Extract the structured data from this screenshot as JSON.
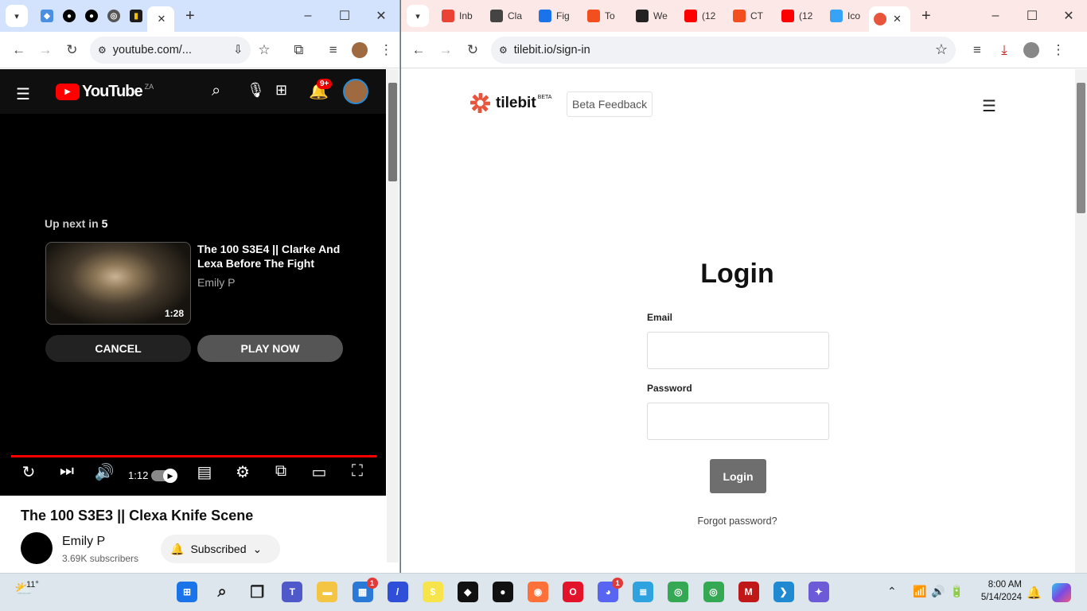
{
  "left_window": {
    "tabs": [
      {
        "favicon": "inbox-icon",
        "color": "#4a90e2"
      },
      {
        "favicon": "github-icon",
        "color": "#000000"
      },
      {
        "favicon": "github-icon",
        "color": "#000000"
      },
      {
        "favicon": "globe-icon",
        "color": "#555555"
      },
      {
        "favicon": "clipboard-icon",
        "color": "#f2c200"
      },
      {
        "favicon": "youtube-icon",
        "color": "#ff0000",
        "active": true
      }
    ],
    "url": "youtube.com/...",
    "youtube": {
      "logo_text": "YouTube",
      "region": "ZA",
      "notification_count": "9+",
      "up_next_label": "Up next in",
      "countdown": "5",
      "next_video_title": "The 100 S3E4 || Clarke And Lexa Before The Fight",
      "next_video_channel": "Emily P",
      "next_video_duration": "1:28",
      "cancel_label": "CANCEL",
      "play_now_label": "PLAY NOW",
      "current_time": "1:12",
      "progress": 1.0,
      "video_title": "The 100 S3E3 || Clexa Knife Scene",
      "channel_name": "Emily P",
      "subscribers": "3.69K subscribers",
      "subscribed_label": "Subscribed"
    }
  },
  "right_window": {
    "tabs": [
      {
        "label": "Inb",
        "favicon": "gmail-icon",
        "color": "#ea4335"
      },
      {
        "label": "Cla",
        "favicon": "contacts-icon",
        "color": "#444444"
      },
      {
        "label": "Fig",
        "favicon": "figma-ext-icon",
        "color": "#1a73e8"
      },
      {
        "label": "To",
        "favicon": "figma-icon",
        "color": "#f24e1e"
      },
      {
        "label": "We",
        "favicon": "webflow-icon",
        "color": "#222222"
      },
      {
        "label": "(12",
        "favicon": "youtube-icon",
        "color": "#ff0000"
      },
      {
        "label": "CT",
        "favicon": "figma-icon",
        "color": "#f24e1e"
      },
      {
        "label": "(12",
        "favicon": "youtube-icon",
        "color": "#ff0000"
      },
      {
        "label": "Ico",
        "favicon": "pinwheel-icon",
        "color": "#36a3f7"
      },
      {
        "label": "",
        "favicon": "tilebit-icon",
        "color": "#e8553d",
        "active": true
      }
    ],
    "url": "tilebit.io/sign-in",
    "page": {
      "brand": "tilebit",
      "brand_tag": "BETA",
      "feedback_label": "Beta Feedback",
      "heading": "Login",
      "email_label": "Email",
      "password_label": "Password",
      "login_button": "Login",
      "forgot_label": "Forgot password?",
      "brand_color": "#e8553d"
    }
  },
  "taskbar": {
    "temperature": "11°",
    "time": "8:00 AM",
    "date": "5/14/2024",
    "apps": [
      {
        "name": "start-icon"
      },
      {
        "name": "search-icon"
      },
      {
        "name": "task-view-icon"
      },
      {
        "name": "teams-icon"
      },
      {
        "name": "file-explorer-icon"
      },
      {
        "name": "store-icon",
        "badge": "1"
      },
      {
        "name": "linear-icon"
      },
      {
        "name": "snapchat-icon"
      },
      {
        "name": "figma-icon"
      },
      {
        "name": "github-desktop-icon"
      },
      {
        "name": "firefox-icon"
      },
      {
        "name": "opera-icon"
      },
      {
        "name": "discord-icon",
        "badge": "1"
      },
      {
        "name": "notepad-icon"
      },
      {
        "name": "chrome-icon"
      },
      {
        "name": "chrome-profile-icon"
      },
      {
        "name": "mcafee-icon"
      },
      {
        "name": "vscode-icon"
      },
      {
        "name": "copilot-icon"
      }
    ]
  }
}
